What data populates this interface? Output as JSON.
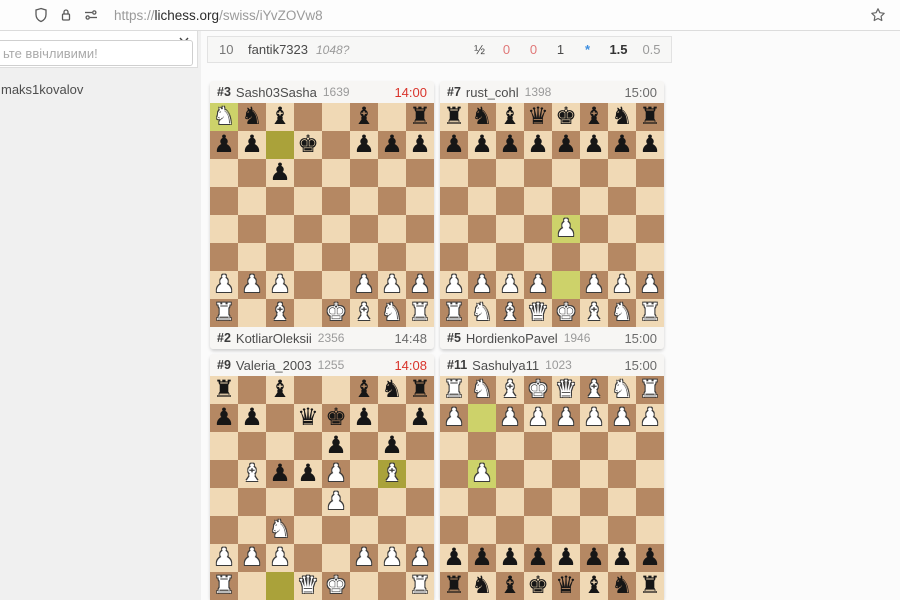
{
  "browser": {
    "url_scheme": "https://",
    "url_host": "lichess.org",
    "url_path": "/swiss/iYvZOVw8"
  },
  "sidebar": {
    "chat_placeholder": "ьте ввічливими!",
    "member": "maks1kovalov"
  },
  "standings_row": {
    "rank": "10",
    "player": "fantik7323",
    "rating": "1048?",
    "scores": [
      "½",
      "0",
      "0",
      "1",
      "*",
      "1.5",
      "0.5"
    ]
  },
  "colors": {
    "clock_active": "#d9342b",
    "score_loss": "#e07878",
    "score_ongoing": "#3d8ee0",
    "board_light": "#f0d9b5",
    "board_dark": "#b58863",
    "highlight_light": "#cdd26a",
    "highlight_dark": "#aaa23a"
  },
  "boards": [
    {
      "top": {
        "rank": "#3",
        "name": "Sash03Sasha",
        "rating": "1639",
        "clock": "14:00",
        "active": true
      },
      "bottom": {
        "rank": "#2",
        "name": "KotliarOleksii",
        "rating": "2356",
        "clock": "14:48",
        "active": false
      },
      "rows": [
        [
          "wN",
          "bN",
          "bB",
          "",
          "",
          "bB",
          "",
          "bR"
        ],
        [
          "bP",
          "bP",
          "",
          "bK",
          "",
          "bP",
          "bP",
          "bP"
        ],
        [
          "",
          "",
          "bP",
          "",
          "",
          "",
          "",
          ""
        ],
        [
          "",
          "",
          "",
          "",
          "",
          "",
          "",
          ""
        ],
        [
          "",
          "",
          "",
          "",
          "",
          "",
          "",
          ""
        ],
        [
          "",
          "",
          "",
          "",
          "",
          "",
          "",
          ""
        ],
        [
          "wP",
          "wP",
          "wP",
          "",
          "",
          "wP",
          "wP",
          "wP"
        ],
        [
          "wR",
          "",
          "wB",
          "",
          "wK",
          "wB",
          "wN",
          "wR"
        ]
      ],
      "highlights": [
        [
          0,
          0
        ],
        [
          1,
          2
        ]
      ]
    },
    {
      "top": {
        "rank": "#7",
        "name": "rust_cohl",
        "rating": "1398",
        "clock": "15:00",
        "active": false
      },
      "bottom": {
        "rank": "#5",
        "name": "HordienkoPavel",
        "rating": "1946",
        "clock": "15:00",
        "active": false
      },
      "rows": [
        [
          "bR",
          "bN",
          "bB",
          "bQ",
          "bK",
          "bB",
          "bN",
          "bR"
        ],
        [
          "bP",
          "bP",
          "bP",
          "bP",
          "bP",
          "bP",
          "bP",
          "bP"
        ],
        [
          "",
          "",
          "",
          "",
          "",
          "",
          "",
          ""
        ],
        [
          "",
          "",
          "",
          "",
          "",
          "",
          "",
          ""
        ],
        [
          "",
          "",
          "",
          "",
          "wP",
          "",
          "",
          ""
        ],
        [
          "",
          "",
          "",
          "",
          "",
          "",
          "",
          ""
        ],
        [
          "wP",
          "wP",
          "wP",
          "wP",
          "",
          "wP",
          "wP",
          "wP"
        ],
        [
          "wR",
          "wN",
          "wB",
          "wQ",
          "wK",
          "wB",
          "wN",
          "wR"
        ]
      ],
      "highlights": [
        [
          4,
          4
        ],
        [
          6,
          4
        ]
      ]
    },
    {
      "top": {
        "rank": "#9",
        "name": "Valeria_2003",
        "rating": "1255",
        "clock": "14:08",
        "active": true
      },
      "bottom": null,
      "rows": [
        [
          "bR",
          "",
          "bB",
          "",
          "",
          "bB",
          "bN",
          "bR"
        ],
        [
          "bP",
          "bP",
          "",
          "bQ",
          "bK",
          "bP",
          "",
          "bP"
        ],
        [
          "",
          "",
          "",
          "",
          "bP",
          "",
          "bP",
          ""
        ],
        [
          "",
          "wB",
          "bP",
          "bP",
          "wP",
          "",
          "wB",
          ""
        ],
        [
          "",
          "",
          "",
          "",
          "wP",
          "",
          "",
          ""
        ],
        [
          "",
          "",
          "wN",
          "",
          "",
          "",
          "",
          ""
        ],
        [
          "wP",
          "wP",
          "wP",
          "",
          "",
          "wP",
          "wP",
          "wP"
        ],
        [
          "wR",
          "",
          "",
          "wQ",
          "wK",
          "",
          "",
          "wR"
        ]
      ],
      "highlights": [
        [
          3,
          6
        ],
        [
          7,
          2
        ]
      ]
    },
    {
      "top": {
        "rank": "#11",
        "name": "Sashulya11",
        "rating": "1023",
        "clock": "15:00",
        "active": false
      },
      "bottom": null,
      "rows": [
        [
          "wR",
          "wN",
          "wB",
          "wK",
          "wQ",
          "wB",
          "wN",
          "wR"
        ],
        [
          "wP",
          "",
          "wP",
          "wP",
          "wP",
          "wP",
          "wP",
          "wP"
        ],
        [
          "",
          "",
          "",
          "",
          "",
          "",
          "",
          ""
        ],
        [
          "",
          "wP",
          "",
          "",
          "",
          "",
          "",
          ""
        ],
        [
          "",
          "",
          "",
          "",
          "",
          "",
          "",
          ""
        ],
        [
          "",
          "",
          "",
          "",
          "",
          "",
          "",
          ""
        ],
        [
          "bP",
          "bP",
          "bP",
          "bP",
          "bP",
          "bP",
          "bP",
          "bP"
        ],
        [
          "bR",
          "bN",
          "bB",
          "bK",
          "bQ",
          "bB",
          "bN",
          "bR"
        ]
      ],
      "highlights": [
        [
          1,
          1
        ],
        [
          3,
          1
        ]
      ]
    }
  ]
}
